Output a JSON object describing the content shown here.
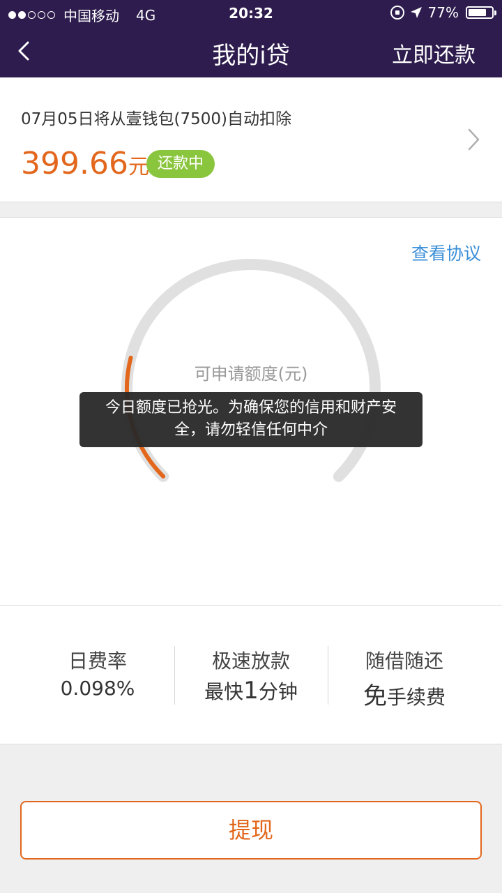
{
  "status": {
    "carrier": "中国移动",
    "network": "4G",
    "time": "20:32",
    "battery": "77%",
    "battery_level": 0.77,
    "signal_bars_filled": 2,
    "signal_bars_total": 5
  },
  "nav": {
    "title": "我的i贷",
    "action": "立即还款",
    "back_icon": "chevron-left-icon"
  },
  "repay": {
    "description": "07月05日将从壹钱包(7500)自动扣除",
    "amount": "399.66",
    "unit": "元",
    "badge": "还款中"
  },
  "credit": {
    "agreement_link": "查看协议",
    "label": "可申请额度(元)",
    "progress_fraction": 0.22
  },
  "toast": {
    "line1": "今日额度已抢光。为确保您的信用和财产安",
    "line2": "全，请勿轻信任何中介"
  },
  "features": [
    {
      "title": "日费率",
      "value": "0.098%"
    },
    {
      "title": "极速放款",
      "value_pre": "最快",
      "value_big": "1",
      "value_post": "分钟"
    },
    {
      "title": "随借随还",
      "value_big": "免",
      "value_post": "手续费"
    }
  ],
  "withdraw_label": "提现",
  "colors": {
    "header_bg": "#2d1c4d",
    "accent_orange": "#e2671c",
    "badge_green": "#8ac53e",
    "link_blue": "#3a8fd8"
  }
}
